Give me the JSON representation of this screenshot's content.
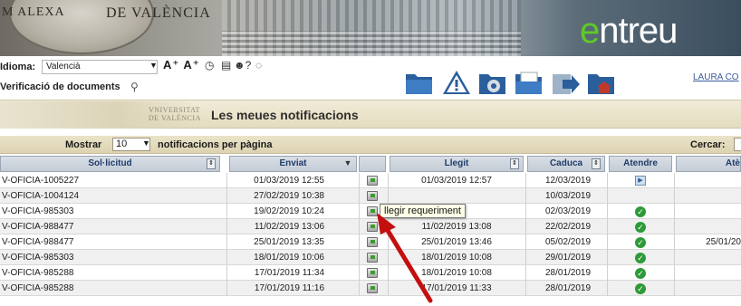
{
  "header": {
    "seal_text": "M ALEXA",
    "brand": "DE VALÈNCIA",
    "logo_accent": "e",
    "logo_rest": "ntreu",
    "logo_green": "#5fcb27"
  },
  "toolbar": {
    "language_label": "Idioma:",
    "language_value": "Valencià",
    "font_tools": "A⁺ A⁺",
    "verification_label": "Verificació de documents",
    "user_link": "LAURA CO",
    "icons": [
      "folder-icon",
      "warning-icon",
      "folder-settings-icon",
      "folder-documents-icon",
      "export-icon",
      "folder-home-icon"
    ]
  },
  "titlebar": {
    "seal_text_line1": "VNIVERSITAT",
    "seal_text_line2": "DE VALÈNCIA",
    "title": "Les meues notificacions"
  },
  "controls": {
    "show_label": "Mostrar",
    "page_size": "10",
    "per_page_label": "notificacions per pàgina",
    "search_label": "Cercar:"
  },
  "table": {
    "columns": [
      "Sol·licitud",
      "Enviat",
      "",
      "Llegit",
      "Caduca",
      "Atendre",
      "Atè"
    ],
    "rows": [
      {
        "sol": "V-OFICIA-1005227",
        "enviat": "01/03/2019 12:55",
        "llegit": "01/03/2019 12:57",
        "caduca": "12/03/2019",
        "atendre": "play",
        "atendre2": ""
      },
      {
        "sol": "V-OFICIA-1004124",
        "enviat": "27/02/2019 10:38",
        "llegit": "",
        "caduca": "10/03/2019",
        "atendre": "",
        "atendre2": ""
      },
      {
        "sol": "V-OFICIA-985303",
        "enviat": "19/02/2019 10:24",
        "llegit": "0:26",
        "caduca": "02/03/2019",
        "atendre": "check",
        "atendre2": ""
      },
      {
        "sol": "V-OFICIA-988477",
        "enviat": "11/02/2019 13:06",
        "llegit": "11/02/2019 13:08",
        "caduca": "22/02/2019",
        "atendre": "check",
        "atendre2": ""
      },
      {
        "sol": "V-OFICIA-988477",
        "enviat": "25/01/2019 13:35",
        "llegit": "25/01/2019 13:46",
        "caduca": "05/02/2019",
        "atendre": "check",
        "atendre2": "25/01/20"
      },
      {
        "sol": "V-OFICIA-985303",
        "enviat": "18/01/2019 10:06",
        "llegit": "18/01/2019 10:08",
        "caduca": "29/01/2019",
        "atendre": "check",
        "atendre2": ""
      },
      {
        "sol": "V-OFICIA-985288",
        "enviat": "17/01/2019 11:34",
        "llegit": "18/01/2019 10:08",
        "caduca": "28/01/2019",
        "atendre": "check",
        "atendre2": ""
      },
      {
        "sol": "V-OFICIA-985288",
        "enviat": "17/01/2019 11:16",
        "llegit": "17/01/2019 11:33",
        "caduca": "28/01/2019",
        "atendre": "check",
        "atendre2": ""
      }
    ]
  },
  "tooltip": {
    "text": "llegir requeriment"
  },
  "colors": {
    "annotation_arrow": "#c40f0f",
    "header_text": "#1f3b6b",
    "check_green": "#2d9a39"
  }
}
